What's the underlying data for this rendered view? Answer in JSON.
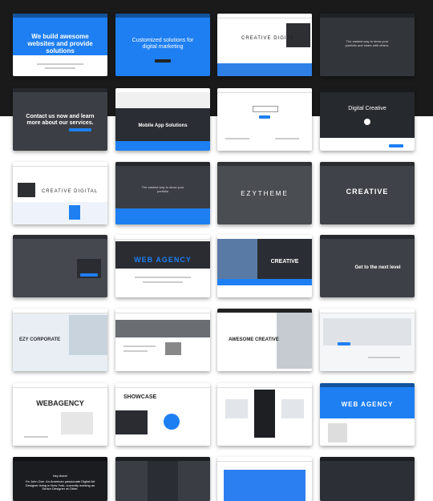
{
  "colors": {
    "blue": "#1e7ff2",
    "dark": "#2a2c31",
    "gray": "#55585e"
  },
  "thumbs": {
    "t1": {
      "text": "We build awesome websites and provide solutions"
    },
    "t2": {
      "text": "Customized solutions for digital marketing"
    },
    "t3": {
      "text": "CREATIVE DIGITA"
    },
    "t4": {
      "text": "The easiest way to show your portfolio and share with others."
    },
    "t5": {
      "text": "Contact us now and learn more about our services."
    },
    "t6": {
      "text": "Mobile App Solutions"
    },
    "t8": {
      "text": "Digital Creative"
    },
    "t9": {
      "text": "CREATIVE DIGITAL"
    },
    "t10": {
      "text": "The easiest way to show your portfolio"
    },
    "t11": {
      "text": "EZYTHEME"
    },
    "t12": {
      "text": "CREATIVE"
    },
    "t14": {
      "text": "WEB AGENCY"
    },
    "t15": {
      "text": "CREATIVE"
    },
    "t16": {
      "text": "Get to the next level"
    },
    "t17": {
      "text": "EZY CORPORATE"
    },
    "t19": {
      "text": "AWESOME CREATIVE"
    },
    "t21": {
      "text": "WEBAGENCY"
    },
    "t22": {
      "text": "SHOWCASE"
    },
    "t24": {
      "text": "WEB AGENCY"
    },
    "t25": {
      "text": "Hey there!"
    },
    "t25b": {
      "text": "I'm John Doe. An American passionate Digital Art Designer living in New York, currently working as Senior Designer at Other."
    }
  }
}
